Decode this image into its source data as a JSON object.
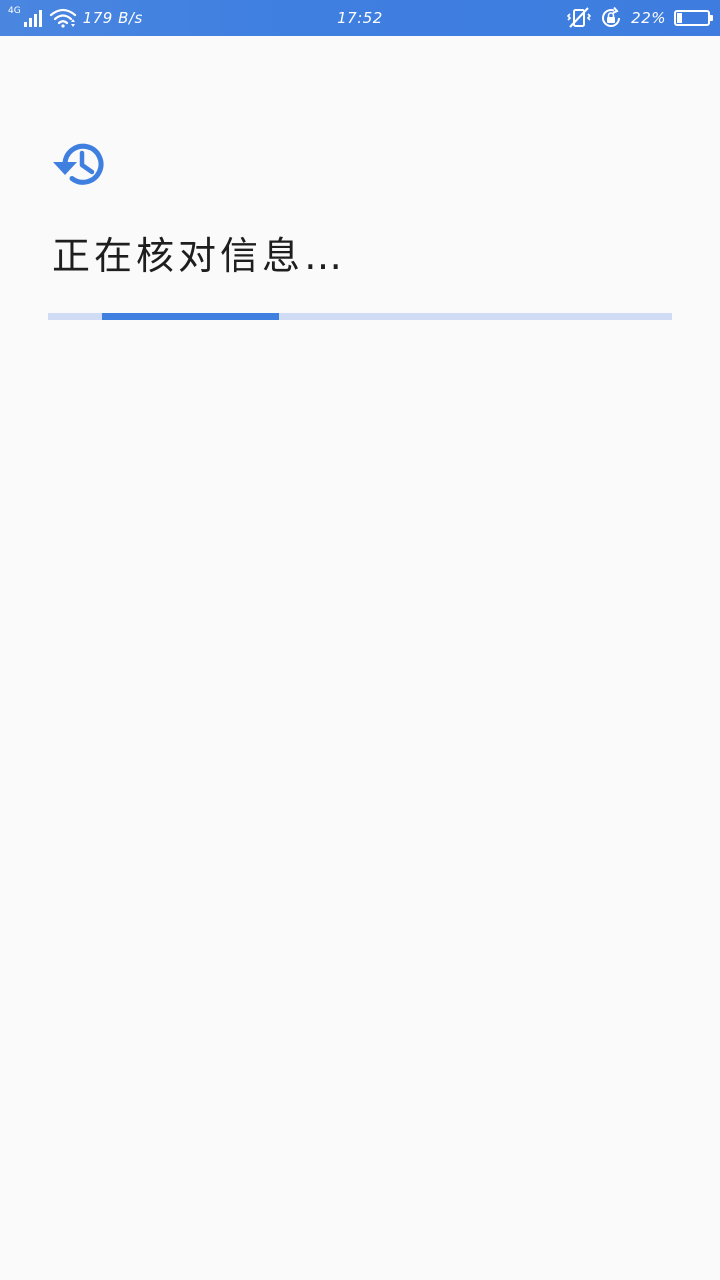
{
  "status_bar": {
    "network_type": "4G",
    "net_speed": "179 B/s",
    "time": "17:52",
    "battery_percent": "22%",
    "battery_level": 0.22,
    "icons": [
      "signal-icon",
      "wifi-icon",
      "vibrate-icon",
      "rotation-lock-icon",
      "battery-icon"
    ]
  },
  "main": {
    "icon": "history-icon",
    "title": "正在核对信息…",
    "progress": {
      "value_start": 0.0865,
      "value_end": 0.37,
      "color": "#3e7fe0",
      "track_color": "#cfdcf4",
      "indeterminate": true
    }
  },
  "colors": {
    "accent": "#3e7fe0",
    "background": "#fafafa",
    "text": "#1e1e1e"
  }
}
